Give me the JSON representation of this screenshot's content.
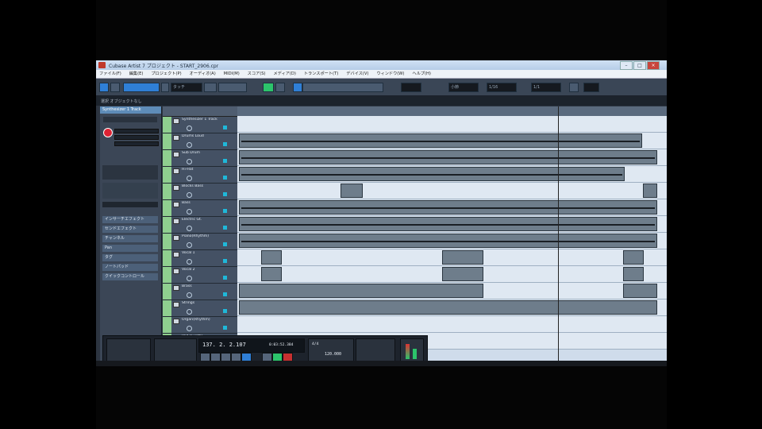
{
  "window": {
    "title": "Cubase Artist 7 プロジェクト - START_2906.cpr",
    "buttons": [
      "–",
      "□",
      "×"
    ]
  },
  "menu": [
    "ファイル(F)",
    "編集(E)",
    "プロジェクト(P)",
    "オーディオ(A)",
    "MIDI(M)",
    "スコア(S)",
    "メディア(D)",
    "トランスポート(T)",
    "デバイス(V)",
    "ウィンドウ(W)",
    "ヘルプ(H)"
  ],
  "toolbar": {
    "mode_field": "タッチ",
    "grid_field": "小節",
    "quantize_field": "1/16",
    "bar_field": "1/1"
  },
  "infoline": {
    "text": "選択 オブジェクトなし"
  },
  "inspector": {
    "header": "Synthesizer 1 Track",
    "rows": [
      "インサーチエフェクト",
      "センドエフェクト",
      "チャンネル",
      "Pan",
      "タグ",
      "ノートパッド",
      "クイックコントロール"
    ]
  },
  "tracks": [
    {
      "name": "Synthesizer 1 Track",
      "color": "#8fcf8f"
    },
    {
      "name": "Drums Loud",
      "color": "#8fcf8f"
    },
    {
      "name": "Sub Drum",
      "color": "#8fcf8f"
    },
    {
      "name": "Hi-Hat",
      "color": "#8fcf8f"
    },
    {
      "name": "Blocks Bass",
      "color": "#8fcf8f"
    },
    {
      "name": "Bass",
      "color": "#8fcf8f"
    },
    {
      "name": "Electric Gt.",
      "color": "#8fcf8f"
    },
    {
      "name": "Piano(Rhythm)",
      "color": "#8fcf8f"
    },
    {
      "name": "Vocal 1",
      "color": "#8fcf8f"
    },
    {
      "name": "Vocal 2",
      "color": "#8fcf8f"
    },
    {
      "name": "Brass",
      "color": "#8fcf8f"
    },
    {
      "name": "Strings",
      "color": "#8fcf8f"
    },
    {
      "name": "Organ(Rhythm)",
      "color": "#8fcf8f"
    },
    {
      "name": "Pad (Synth)",
      "color": "#8fcf8f"
    }
  ],
  "transport": {
    "position": "137. 2. 2.107",
    "time": "0:03:52.384",
    "tempo": "120.000",
    "signature": "4/4"
  }
}
